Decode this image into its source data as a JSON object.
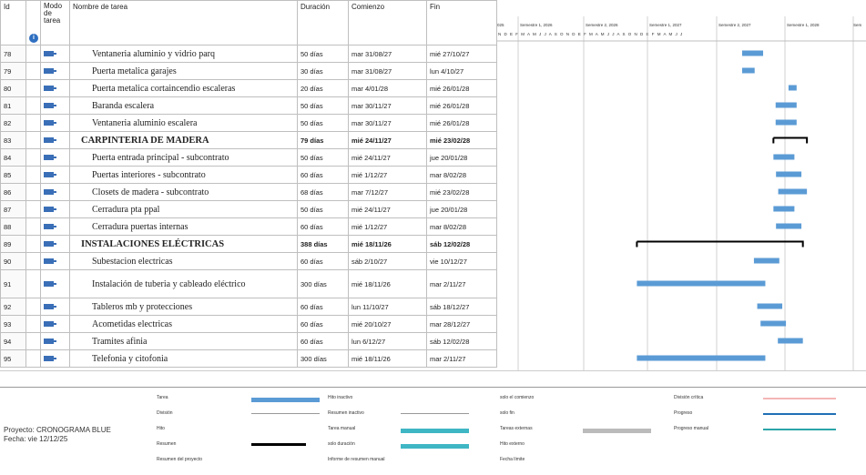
{
  "columns": {
    "id": "Id",
    "info": "i",
    "mode": "Modo de tarea",
    "name": "Nombre de tarea",
    "duration": "Duración",
    "start": "Comienzo",
    "finish": "Fin"
  },
  "rows": [
    {
      "id": "78",
      "name": "Ventaneria aluminio y vidrio parq",
      "duration": "50 días",
      "start": "mar 31/08/27",
      "finish": "mié 27/10/27",
      "summary": false
    },
    {
      "id": "79",
      "name": "Puerta metalica garajes",
      "duration": "30 días",
      "start": "mar 31/08/27",
      "finish": "lun 4/10/27",
      "summary": false
    },
    {
      "id": "80",
      "name": "Puerta metalica cortaincendio escaleras",
      "duration": "20 días",
      "start": "mar 4/01/28",
      "finish": "mié 26/01/28",
      "summary": false
    },
    {
      "id": "81",
      "name": "Baranda escalera",
      "duration": "50 días",
      "start": "mar 30/11/27",
      "finish": "mié 26/01/28",
      "summary": false
    },
    {
      "id": "82",
      "name": "Ventaneria aluminio escalera",
      "duration": "50 días",
      "start": "mar 30/11/27",
      "finish": "mié 26/01/28",
      "summary": false
    },
    {
      "id": "83",
      "name": "CARPINTERIA DE MADERA",
      "duration": "79 días",
      "start": "mié 24/11/27",
      "finish": "mié 23/02/28",
      "summary": true
    },
    {
      "id": "84",
      "name": "Puerta entrada principal - subcontrato",
      "duration": "50 días",
      "start": "mié 24/11/27",
      "finish": "jue 20/01/28",
      "summary": false
    },
    {
      "id": "85",
      "name": "Puertas interiores - subcontrato",
      "duration": "60 días",
      "start": "mié 1/12/27",
      "finish": "mar 8/02/28",
      "summary": false
    },
    {
      "id": "86",
      "name": "Closets de madera - subcontrato",
      "duration": "68 días",
      "start": "mar 7/12/27",
      "finish": "mié 23/02/28",
      "summary": false
    },
    {
      "id": "87",
      "name": "Cerradura pta ppal",
      "duration": "50 días",
      "start": "mié 24/11/27",
      "finish": "jue 20/01/28",
      "summary": false
    },
    {
      "id": "88",
      "name": "Cerradura puertas internas",
      "duration": "60 días",
      "start": "mié 1/12/27",
      "finish": "mar 8/02/28",
      "summary": false
    },
    {
      "id": "89",
      "name": "INSTALACIONES ELÉCTRICAS",
      "duration": "388 días",
      "start": "mié 18/11/26",
      "finish": "sáb 12/02/28",
      "summary": true
    },
    {
      "id": "90",
      "name": "Subestacion electricas",
      "duration": "60 días",
      "start": "sáb 2/10/27",
      "finish": "vie 10/12/27",
      "summary": false
    },
    {
      "id": "91",
      "name": "Instalación de tuberia y cableado eléctrico",
      "duration": "300 días",
      "start": "mié 18/11/26",
      "finish": "mar 2/11/27",
      "summary": false
    },
    {
      "id": "92",
      "name": "Tableros mb y protecciones",
      "duration": "60 días",
      "start": "lun 11/10/27",
      "finish": "sáb 18/12/27",
      "summary": false
    },
    {
      "id": "93",
      "name": "Acometidas electricas",
      "duration": "60 días",
      "start": "mié 20/10/27",
      "finish": "mar 28/12/27",
      "summary": false
    },
    {
      "id": "94",
      "name": "Tramites afinia",
      "duration": "60 días",
      "start": "lun 6/12/27",
      "finish": "sáb 12/02/28",
      "summary": false
    },
    {
      "id": "95",
      "name": "Telefonia y citofonia",
      "duration": "300 días",
      "start": "mié 18/11/26",
      "finish": "mar 2/11/27",
      "summary": false
    }
  ],
  "timeline": {
    "periods": [
      "025",
      "Semestre 1, 2026",
      "Semestre 2, 2026",
      "Semestre 1, 2027",
      "Semestre 2, 2027",
      "Semestre 1, 2028",
      "Sem"
    ],
    "months": "N D E F M A M J J A S O N D E F M A M J J A S O N D E F M A M J J"
  },
  "legend": {
    "project": "Proyecto: CRONOGRAMA BLUE",
    "date": "Fecha: vie 12/12/25",
    "col1": [
      "Tarea",
      "División",
      "Hito",
      "Resumen",
      "Resumen del proyecto"
    ],
    "col2": [
      "Hito inactivo",
      "Resumen inactivo",
      "Tarea manual",
      "solo duración",
      "Informe de resumen manual"
    ],
    "col3": [
      "solo el comienzo",
      "solo fin",
      "Tareas externas",
      "Hito externo",
      "Fecha límite"
    ],
    "col4": [
      "División crítica",
      "Progreso",
      "Progreso manual"
    ]
  },
  "colors": {
    "task": "#5b9bd5",
    "summary": "#000000",
    "grid": "#bfbfbf",
    "critical_split": "#f4b6b6",
    "progress": "#1f6fb5"
  }
}
